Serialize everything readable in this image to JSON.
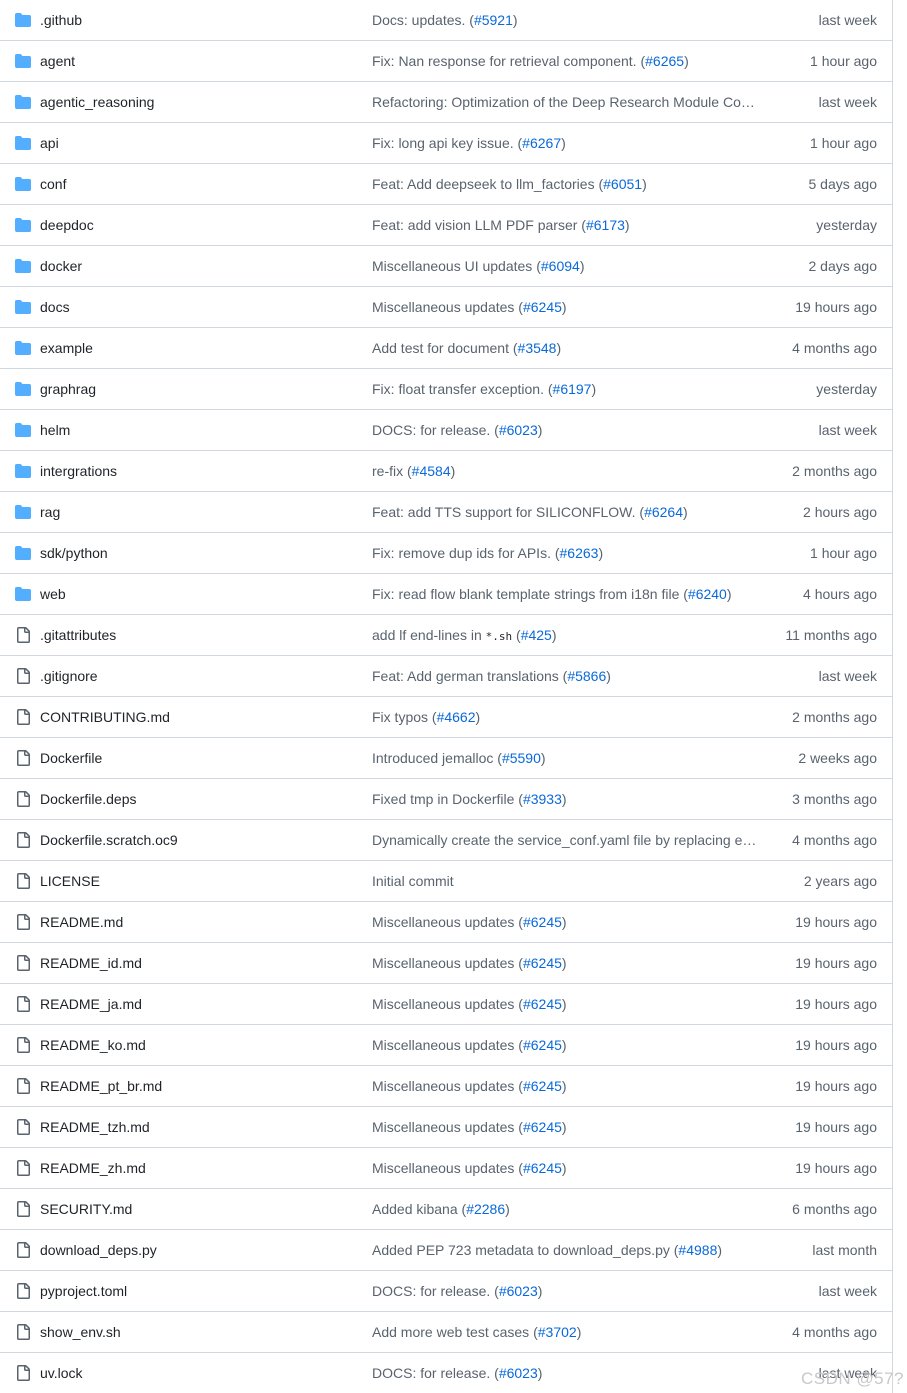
{
  "files": [
    {
      "type": "dir",
      "name": ".github",
      "msg": "Docs: updates. (",
      "ref": "#5921",
      "tail": ")",
      "time": "last week"
    },
    {
      "type": "dir",
      "name": "agent",
      "msg": "Fix: Nan response for retrieval component. (",
      "ref": "#6265",
      "tail": ")",
      "time": "1 hour ago"
    },
    {
      "type": "dir",
      "name": "agentic_reasoning",
      "msg": "Refactoring: Optimization of the Deep Research Module Cod…",
      "ref": "",
      "tail": "",
      "time": "last week"
    },
    {
      "type": "dir",
      "name": "api",
      "msg": "Fix: long api key issue. (",
      "ref": "#6267",
      "tail": ")",
      "time": "1 hour ago"
    },
    {
      "type": "dir",
      "name": "conf",
      "msg": "Feat: Add deepseek to llm_factories (",
      "ref": "#6051",
      "tail": ")",
      "time": "5 days ago"
    },
    {
      "type": "dir",
      "name": "deepdoc",
      "msg": "Feat: add vision LLM PDF parser (",
      "ref": "#6173",
      "tail": ")",
      "time": "yesterday"
    },
    {
      "type": "dir",
      "name": "docker",
      "msg": "Miscellaneous UI updates (",
      "ref": "#6094",
      "tail": ")",
      "time": "2 days ago"
    },
    {
      "type": "dir",
      "name": "docs",
      "msg": "Miscellaneous updates (",
      "ref": "#6245",
      "tail": ")",
      "time": "19 hours ago"
    },
    {
      "type": "dir",
      "name": "example",
      "msg": "Add test for document (",
      "ref": "#3548",
      "tail": ")",
      "time": "4 months ago"
    },
    {
      "type": "dir",
      "name": "graphrag",
      "msg": "Fix: float transfer exception. (",
      "ref": "#6197",
      "tail": ")",
      "time": "yesterday"
    },
    {
      "type": "dir",
      "name": "helm",
      "msg": "DOCS: for release. (",
      "ref": "#6023",
      "tail": ")",
      "time": "last week"
    },
    {
      "type": "dir",
      "name": "intergrations",
      "msg": "re-fix (",
      "ref": "#4584",
      "tail": ")",
      "time": "2 months ago"
    },
    {
      "type": "dir",
      "name": "rag",
      "msg": "Feat: add TTS support for SILICONFLOW. (",
      "ref": "#6264",
      "tail": ")",
      "time": "2 hours ago"
    },
    {
      "type": "dir",
      "name": "sdk/python",
      "msg": "Fix: remove dup ids for APIs. (",
      "ref": "#6263",
      "tail": ")",
      "time": "1 hour ago"
    },
    {
      "type": "dir",
      "name": "web",
      "msg": "Fix: read flow blank template strings from i18n file (",
      "ref": "#6240",
      "tail": ")",
      "time": "4 hours ago"
    },
    {
      "type": "file",
      "name": ".gitattributes",
      "msg": "add lf end-lines in ",
      "code": "*.sh",
      "msg2": " (",
      "ref": "#425",
      "tail": ")",
      "time": "11 months ago"
    },
    {
      "type": "file",
      "name": ".gitignore",
      "msg": "Feat: Add german translations (",
      "ref": "#5866",
      "tail": ")",
      "time": "last week"
    },
    {
      "type": "file",
      "name": "CONTRIBUTING.md",
      "msg": "Fix typos (",
      "ref": "#4662",
      "tail": ")",
      "time": "2 months ago"
    },
    {
      "type": "file",
      "name": "Dockerfile",
      "msg": "Introduced jemalloc (",
      "ref": "#5590",
      "tail": ")",
      "time": "2 weeks ago"
    },
    {
      "type": "file",
      "name": "Dockerfile.deps",
      "msg": "Fixed tmp in Dockerfile (",
      "ref": "#3933",
      "tail": ")",
      "time": "3 months ago"
    },
    {
      "type": "file",
      "name": "Dockerfile.scratch.oc9",
      "msg": "Dynamically create the service_conf.yaml file by replacing en…",
      "ref": "",
      "tail": "",
      "time": "4 months ago"
    },
    {
      "type": "file",
      "name": "LICENSE",
      "msg": "Initial commit",
      "ref": "",
      "tail": "",
      "time": "2 years ago"
    },
    {
      "type": "file",
      "name": "README.md",
      "msg": "Miscellaneous updates (",
      "ref": "#6245",
      "tail": ")",
      "time": "19 hours ago"
    },
    {
      "type": "file",
      "name": "README_id.md",
      "msg": "Miscellaneous updates (",
      "ref": "#6245",
      "tail": ")",
      "time": "19 hours ago"
    },
    {
      "type": "file",
      "name": "README_ja.md",
      "msg": "Miscellaneous updates (",
      "ref": "#6245",
      "tail": ")",
      "time": "19 hours ago"
    },
    {
      "type": "file",
      "name": "README_ko.md",
      "msg": "Miscellaneous updates (",
      "ref": "#6245",
      "tail": ")",
      "time": "19 hours ago"
    },
    {
      "type": "file",
      "name": "README_pt_br.md",
      "msg": "Miscellaneous updates (",
      "ref": "#6245",
      "tail": ")",
      "time": "19 hours ago"
    },
    {
      "type": "file",
      "name": "README_tzh.md",
      "msg": "Miscellaneous updates (",
      "ref": "#6245",
      "tail": ")",
      "time": "19 hours ago"
    },
    {
      "type": "file",
      "name": "README_zh.md",
      "msg": "Miscellaneous updates (",
      "ref": "#6245",
      "tail": ")",
      "time": "19 hours ago"
    },
    {
      "type": "file",
      "name": "SECURITY.md",
      "msg": "Added kibana (",
      "ref": "#2286",
      "tail": ")",
      "time": "6 months ago"
    },
    {
      "type": "file",
      "name": "download_deps.py",
      "msg": "Added PEP 723 metadata to download_deps.py (",
      "ref": "#4988",
      "tail": ")",
      "time": "last month"
    },
    {
      "type": "file",
      "name": "pyproject.toml",
      "msg": "DOCS: for release. (",
      "ref": "#6023",
      "tail": ")",
      "time": "last week"
    },
    {
      "type": "file",
      "name": "show_env.sh",
      "msg": "Add more web test cases (",
      "ref": "#3702",
      "tail": ")",
      "time": "4 months ago"
    },
    {
      "type": "file",
      "name": "uv.lock",
      "msg": "DOCS: for release. (",
      "ref": "#6023",
      "tail": ")",
      "time": "last week"
    }
  ],
  "icons": {
    "dir": "folder-icon",
    "file": "file-icon"
  },
  "colors": {
    "folder": "#54aeff",
    "file_icon": "#59636e",
    "link": "#0969da",
    "border": "#d0d7de"
  },
  "watermark": "CSDN @57?"
}
